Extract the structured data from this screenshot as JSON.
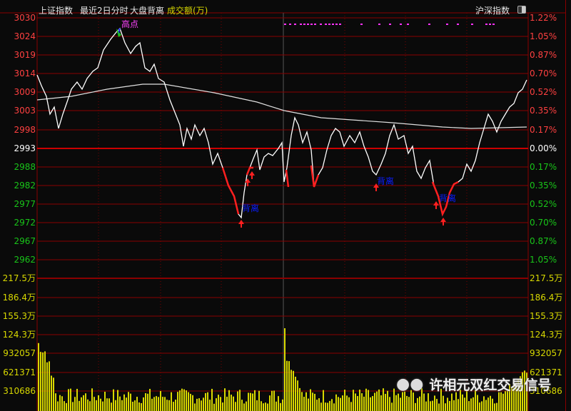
{
  "header": {
    "index_name": "上证指数",
    "period": "最近2日分时",
    "indicator": "大盘背离",
    "volume_label": "成交额(万)",
    "compare_label": "沪深指数"
  },
  "price_axis": [
    "3030",
    "3024",
    "3019",
    "3014",
    "3009",
    "3003",
    "2998",
    "2993",
    "2988",
    "2982",
    "2977",
    "2972",
    "2967",
    "2962"
  ],
  "pct_axis": [
    "1.22%",
    "1.05%",
    "0.87%",
    "0.70%",
    "0.52%",
    "0.35%",
    "0.17%",
    "0.00%",
    "0.17%",
    "0.35%",
    "0.52%",
    "0.70%",
    "0.87%",
    "1.05%"
  ],
  "volume_axis": [
    "217.5万",
    "186.4万",
    "155.3万",
    "124.3万",
    "932057",
    "621371",
    "310686"
  ],
  "annotations": {
    "high": "高点",
    "divergence": "背离"
  },
  "watermark": "许相元双红交易信号",
  "colors": {
    "up": "#ff3b3b",
    "down": "#19c519",
    "neutral": "#ffffff",
    "volume": "#d8d800",
    "grid": "#8b0000",
    "label": "#0a1eff",
    "high": "#ff44ff"
  }
}
